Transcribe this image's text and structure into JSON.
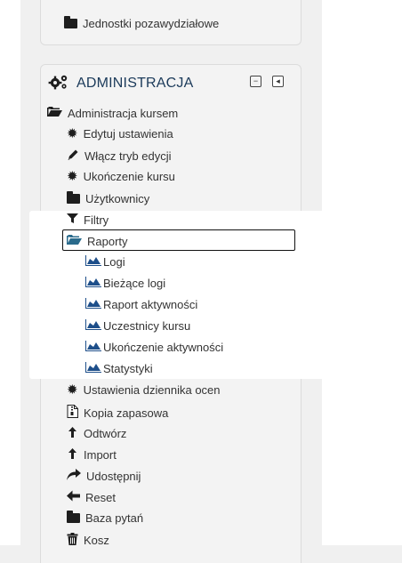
{
  "top_block": {
    "item_label": "Jednostki pozawydziałowe"
  },
  "admin_block": {
    "title": "ADMINISTRACJA",
    "course_admin": {
      "label": "Administracja kursem",
      "items": {
        "edit_settings": "Edytuj ustawienia",
        "edit_mode": "Włącz tryb edycji",
        "course_completion": "Ukończenie kursu",
        "users": "Użytkownicy",
        "filters": "Filtry",
        "reports": {
          "label": "Raporty",
          "children": {
            "logs": "Logi",
            "live_logs": "Bieżące logi",
            "activity_report": "Raport aktywności",
            "participation": "Uczestnicy kursu",
            "activity_completion": "Ukończenie aktywności",
            "statistics": "Statystyki"
          }
        },
        "gradebook_setup": "Ustawienia dziennika ocen",
        "backup": "Kopia zapasowa",
        "restore": "Odtwórz",
        "import": "Import",
        "share": "Udostępnij",
        "reset": "Reset",
        "question_bank": "Baza pytań",
        "recycle_bin": "Kosz"
      }
    }
  },
  "colors": {
    "page_bg": "#f0f0f0",
    "title_text": "#1b3a5a",
    "open_folder": "#2a6b8c",
    "report_icon": "#1e4f8a"
  }
}
